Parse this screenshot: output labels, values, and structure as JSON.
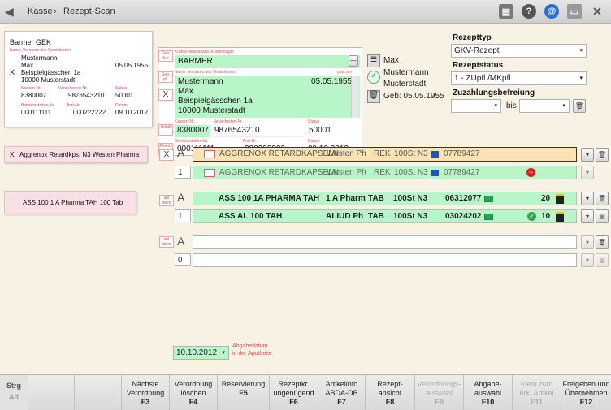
{
  "breadcrumb": {
    "home": "Kasse",
    "sep": "›",
    "current": "Rezept-Scan"
  },
  "scan_main": {
    "kasse": "Barmer GEK",
    "name_label": "Name, Vorname des Versicherten",
    "last": "Mustermann",
    "first": "Max",
    "dob": "05.05.1955",
    "street": "Beispielgässchen 1a",
    "city": "10000 Musterstadt",
    "kassen_nr": "8380007",
    "vers_nr": "9876543210",
    "status": "50001",
    "bst_nr": "000111111",
    "arzt_nr": "000222222",
    "datum": "09.10.2012",
    "kassen_nr_label": "Kassen-Nr.",
    "vers_nr_label": "Versicherten-Nr.",
    "status_label": "Status",
    "bst_label": "Betriebsstätten-Nr.",
    "arzt_label": "Arzt-Nr.",
    "datum_label": "Datum"
  },
  "form": {
    "kk_label": "Krankenkasse bzw. Kostenträger",
    "kk_value": "BARMER",
    "name_label": "Name, Vorname des Versicherten",
    "dob_label": "geb. am",
    "last": "Mustermann",
    "first": "Max",
    "street": "Beispielgässchen 1a",
    "city": "10000 Musterstadt",
    "dob": "05.05.1955",
    "kassen_nr_label": "Kassen-Nr.",
    "vers_nr_label": "Versicherten-Nr.",
    "status_label": "Status",
    "kassen_nr": "8380007",
    "vers_nr": "9876543210",
    "status": "50001",
    "bst_label": "Betriebsstätten-Nr.",
    "arzt_label": "Arzt-Nr.",
    "datum_label": "Datum",
    "bst_nr": "000111111",
    "arzt_nr": "000222222",
    "datum": "09.10.2012",
    "tags": [
      "Geb. frei",
      "Geb. pfl.",
      "X",
      "Unfall",
      "Arbeits unfall"
    ]
  },
  "patient": {
    "first": "Max",
    "last": "Mustermann",
    "city": "Musterstadt",
    "dob": "Geb: 05.05.1955"
  },
  "right": {
    "rezepttyp_label": "Rezepttyp",
    "rezepttyp": "GKV-Rezept",
    "rezeptstatus_label": "Rezeptstatus",
    "rezeptstatus": "1 - ZUpfl./MKpfl.",
    "zuzahlung_label": "Zuzahlungsbefreiung",
    "bis": "bis"
  },
  "rx": [
    {
      "scan": "Aggrenox Retardkps. N3 Westen Pharma",
      "a": "A",
      "article": "AGGRENOX RETARDKAPSELN",
      "hersteller": "Westen Ph",
      "darr": "REK",
      "pack": "100St N3",
      "pzn": "07789427",
      "qty": "1",
      "article2": "AGGRENOX RETARDKAPSELN",
      "hersteller2": "Westen Ph",
      "darr2": "REK",
      "pack2": "100St N3",
      "pzn2": "07789427"
    },
    {
      "scan": "ASS 100 1 A Pharma TAH 100 Tab",
      "a": "A",
      "article": "ASS 100 1A PHARMA TAH",
      "hersteller": "1 A Pharm",
      "darr": "TAB",
      "pack": "100St N3",
      "pzn": "06312077",
      "stock": "20",
      "qty": "1",
      "article2": "ASS AL 100 TAH",
      "hersteller2": "ALIUD Ph",
      "darr2": "TAB",
      "pack2": "100St N3",
      "pzn2": "03024202",
      "stock2": "10"
    },
    {
      "a": "A",
      "qty": "0"
    }
  ],
  "abgabe": {
    "date": "10.10.2012",
    "label1": "Abgabedatum",
    "label2": "in der Apotheke"
  },
  "footer": {
    "strg": "Strg",
    "alt": "Alt",
    "keys": [
      {
        "l1": "Nächste",
        "l2": "Verordnung",
        "k": "F3"
      },
      {
        "l1": "Verordnung",
        "l2": "löschen",
        "k": "F4"
      },
      {
        "l1": "Reservierung",
        "l2": "",
        "k": "F5"
      },
      {
        "l1": "Rezeptkr.",
        "l2": "ungenügend",
        "k": "F6"
      },
      {
        "l1": "Artikelinfo",
        "l2": "ABDA-DB",
        "k": "F7"
      },
      {
        "l1": "Rezept-",
        "l2": "ansicht",
        "k": "F8"
      },
      {
        "l1": "Verordnungs-",
        "l2": "auswahl",
        "k": "F9"
      },
      {
        "l1": "Abgabe-",
        "l2": "auswahl",
        "k": "F10"
      },
      {
        "l1": "Idem zum",
        "l2": "erk. Artikel",
        "k": "F11"
      },
      {
        "l1": "Freigeben und",
        "l2": "Übernehmen",
        "k": "F12"
      }
    ]
  }
}
